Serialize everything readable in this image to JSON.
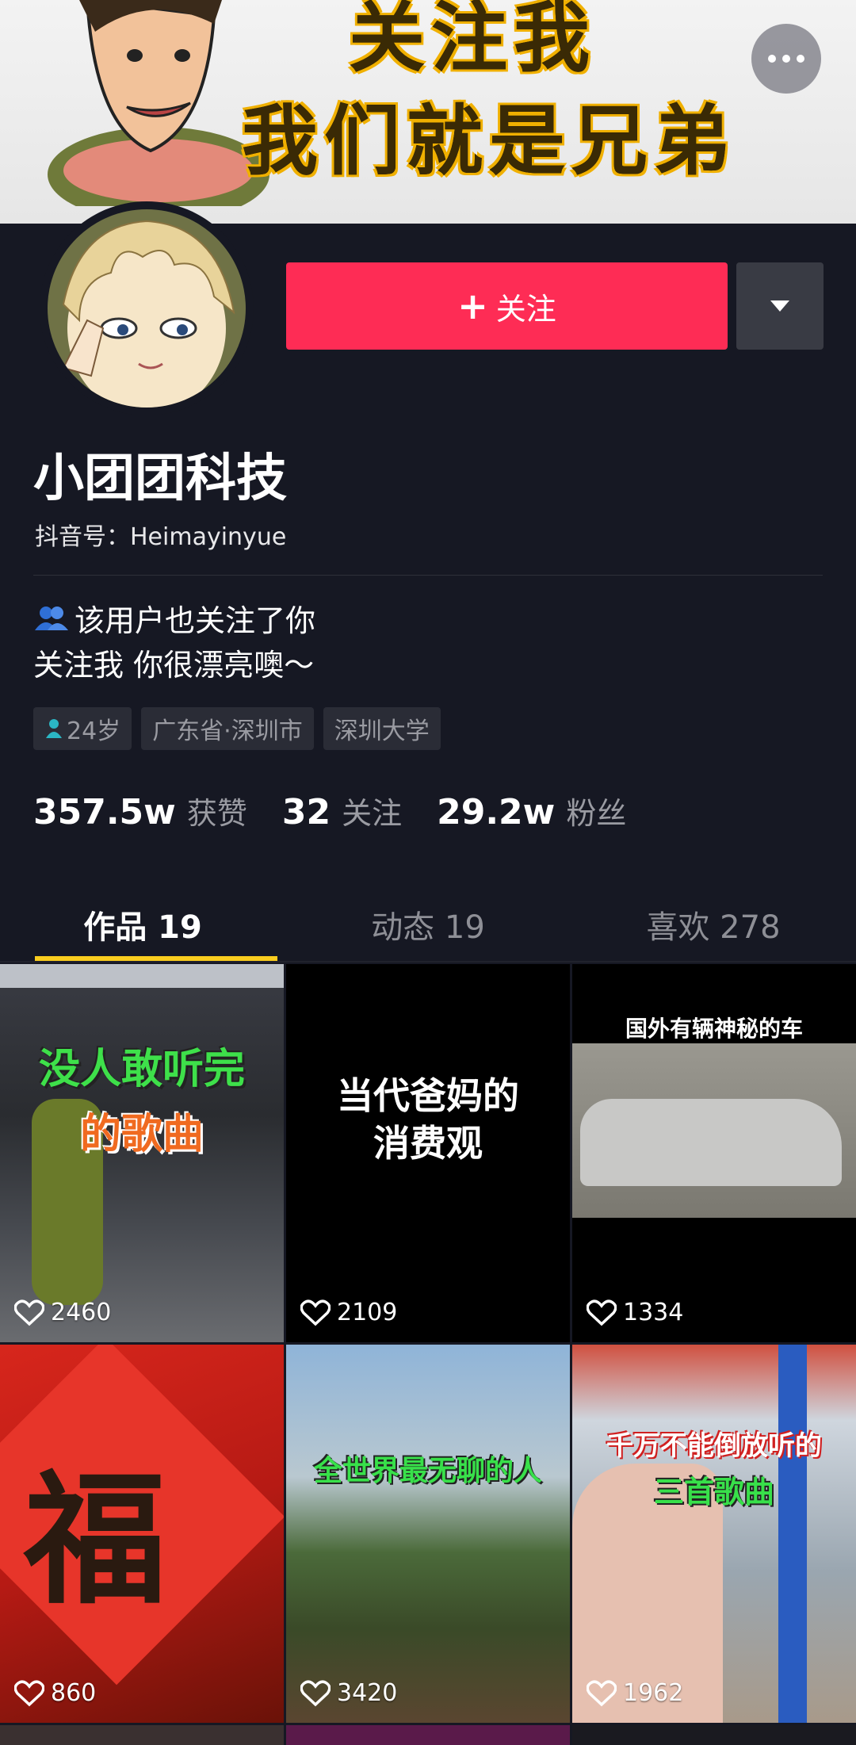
{
  "banner": {
    "line1": "关注我",
    "line2": "我们就是兄弟"
  },
  "profile": {
    "follow_label": "关注",
    "name": "小团团科技",
    "douyin_id": "抖音号：Heimayinyue",
    "mutual_text": "该用户也关注了你",
    "bio": "关注我 你很漂亮噢～",
    "tags": [
      "24岁",
      "广东省·深圳市",
      "深圳大学"
    ]
  },
  "stats": [
    {
      "value": "357.5w",
      "label": "获赞"
    },
    {
      "value": "32",
      "label": "关注"
    },
    {
      "value": "29.2w",
      "label": "粉丝"
    }
  ],
  "tabs": [
    {
      "label": "作品 19",
      "active": true
    },
    {
      "label": "动态 19",
      "active": false
    },
    {
      "label": "喜欢 278",
      "active": false
    }
  ],
  "videos": [
    {
      "caption1": "没人敢听完",
      "caption2": "的歌曲",
      "likes": "2460"
    },
    {
      "caption1": "当代爸妈的",
      "caption2": "消费观",
      "likes": "2109"
    },
    {
      "caption1": "国外有辆神秘的车",
      "caption2": "",
      "likes": "1334"
    },
    {
      "caption1": "",
      "caption2": "",
      "likes": "860"
    },
    {
      "caption1": "全世界最无聊的人",
      "caption2": "",
      "likes": "3420"
    },
    {
      "caption1": "千万不能倒放听的",
      "caption2": "三首歌曲",
      "likes": "1962"
    }
  ],
  "colors": {
    "background": "#161823",
    "follow": "#fe2c55",
    "tab_indicator": "#facd1e"
  }
}
